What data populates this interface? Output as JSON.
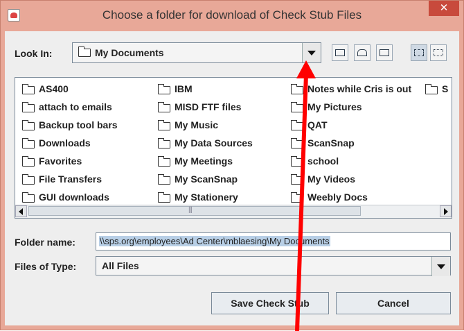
{
  "window": {
    "title": "Choose a folder for download of Check Stub Files",
    "close_glyph": "✕"
  },
  "lookin": {
    "label": "Look In:",
    "value": "My Documents"
  },
  "toolbar": {
    "icons": [
      "up-one-level-icon",
      "home-icon",
      "new-folder-icon",
      "list-view-icon",
      "details-view-icon"
    ]
  },
  "files": [
    "AS400",
    "attach to emails",
    "Backup tool bars",
    "Downloads",
    "Favorites",
    "File Transfers",
    "GUI downloads",
    "IBM",
    "MISD FTF files",
    "My Music",
    "My Data Sources",
    "My Meetings",
    "My ScanSnap",
    "My Stationery",
    "Notes while Cris is out",
    "My Pictures",
    "QAT",
    "ScanSnap",
    "school",
    "My Videos",
    "Weebly Docs",
    "S"
  ],
  "folder_name": {
    "label": "Folder name:",
    "value": "\\\\sps.org\\employees\\Ad Center\\mblaesing\\My Documents"
  },
  "files_of_type": {
    "label": "Files of Type:",
    "value": "All Files"
  },
  "buttons": {
    "save": "Save Check Stub",
    "cancel": "Cancel"
  },
  "colors": {
    "titlebar": "#e8a898",
    "close": "#c84a3c",
    "annotation_arrow": "#ff0000"
  }
}
